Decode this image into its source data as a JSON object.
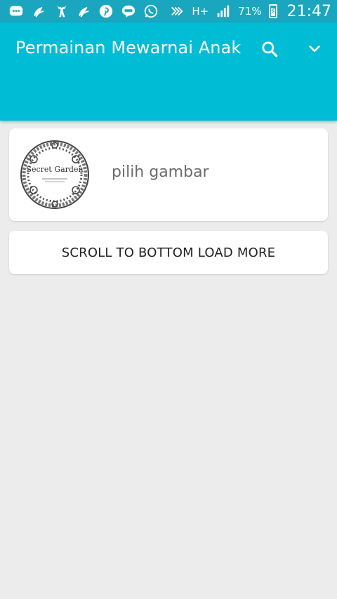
{
  "status_bar": {
    "icons_left": [
      "chat-icon",
      "sprout-icon",
      "deer-icon",
      "sprout-icon",
      "pinterest-icon",
      "line-icon",
      "whatsapp-icon"
    ],
    "icons_right": [
      "nfc-icon",
      "hplus-icon",
      "signal-icon"
    ],
    "network": "H+",
    "battery": "71%",
    "time": "21:47"
  },
  "app_bar": {
    "title": "Permainan Mewarnai Anak",
    "color": "#00BCD4",
    "actions": [
      "search-icon",
      "chevron-down-icon"
    ]
  },
  "list": {
    "items": [
      {
        "thumbnail_title": "Secret Garden",
        "label": "pilih gambar"
      }
    ],
    "load_more_label": "SCROLL TO BOTTOM LOAD MORE"
  }
}
